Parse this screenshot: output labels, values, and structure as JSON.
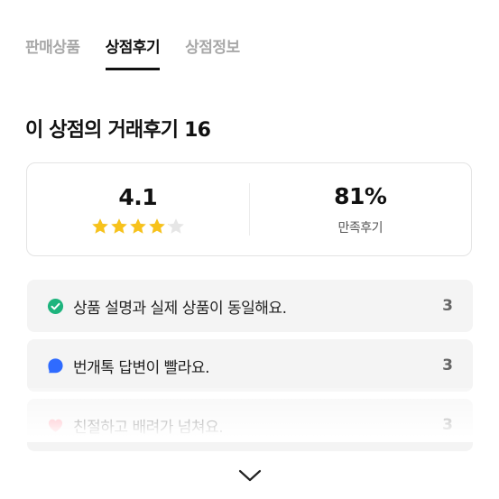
{
  "tabs": [
    {
      "label": "판매상품",
      "active": false
    },
    {
      "label": "상점후기",
      "active": true
    },
    {
      "label": "상점정보",
      "active": false
    }
  ],
  "section_title": "이 상점의 거래후기 16",
  "summary": {
    "rating": "4.1",
    "rating_value": 4.1,
    "rating_max": 5,
    "satisfaction": "81%",
    "satisfaction_label": "만족후기",
    "star_color": "#f7c21b"
  },
  "review_tags": [
    {
      "text": "상품 설명과 실제 상품이 동일해요.",
      "count": "3",
      "icon": "check-circle-icon",
      "color": "#1eb47d"
    },
    {
      "text": "번개톡 답변이 빨라요.",
      "count": "3",
      "icon": "chat-bubble-icon",
      "color": "#2f6bff"
    },
    {
      "text": "친절하고 배려가 넘쳐요.",
      "count": "3",
      "icon": "heart-icon",
      "color": "#ff7a8a"
    }
  ],
  "expand": {
    "icon": "chevron-down-icon"
  }
}
